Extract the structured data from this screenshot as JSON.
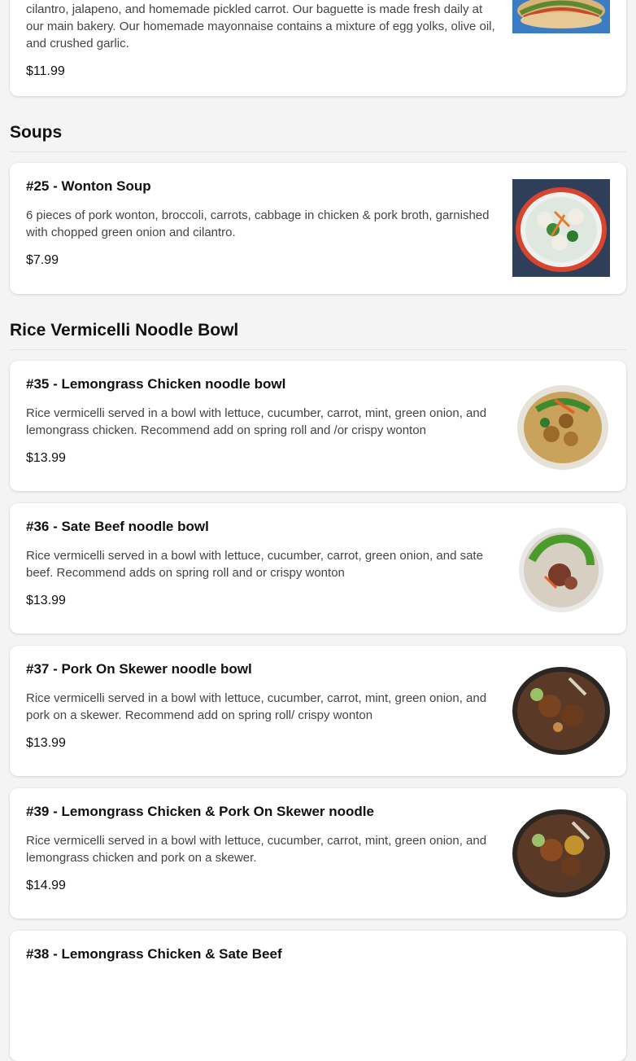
{
  "items_top": {
    "banh_mi": {
      "description_partial": "cilantro, jalapeno, and homemade pickled carrot. Our baguette is made fresh daily at our main bakery. Our homemade mayonnaise contains a mixture of egg yolks, olive oil, and crushed garlic.",
      "price": "$11.99"
    }
  },
  "sections": {
    "soups": {
      "title": "Soups",
      "items": [
        {
          "title": "#25 - Wonton Soup",
          "description": "6 pieces of pork wonton, broccoli, carrots, cabbage in chicken & pork broth, garnished with chopped green onion and cilantro.",
          "price": "$7.99"
        }
      ]
    },
    "noodle_bowl": {
      "title": "Rice Vermicelli Noodle Bowl",
      "items": [
        {
          "title": "#35 - Lemongrass Chicken noodle bowl",
          "description": "Rice vermicelli served in a bowl with lettuce, cucumber, carrot, mint, green onion, and lemongrass chicken. Recommend add on spring roll and /or crispy wonton",
          "price": "$13.99"
        },
        {
          "title": "#36 - Sate Beef noodle bowl",
          "description": "Rice vermicelli served in a bowl with lettuce, cucumber, carrot, green onion, and sate beef. Recommend adds on spring roll and or crispy wonton",
          "price": "$13.99"
        },
        {
          "title": "#37 - Pork On Skewer noodle bowl",
          "description": "Rice vermicelli served in a bowl with lettuce, cucumber, carrot, mint, green onion, and pork on a skewer. Recommend add on spring roll/ crispy wonton",
          "price": "$13.99"
        },
        {
          "title": "#39 - Lemongrass Chicken & Pork On Skewer noodle",
          "description": "Rice vermicelli served in a bowl with lettuce, cucumber, carrot, mint, green onion, and lemongrass chicken and pork on a skewer.",
          "price": "$14.99"
        },
        {
          "title": "#38 - Lemongrass Chicken & Sate Beef"
        }
      ]
    }
  },
  "icons": {
    "banh_mi_image": "sandwich-photo",
    "wonton_image": "wonton-soup-photo",
    "noodle_image": "noodle-bowl-photo"
  }
}
